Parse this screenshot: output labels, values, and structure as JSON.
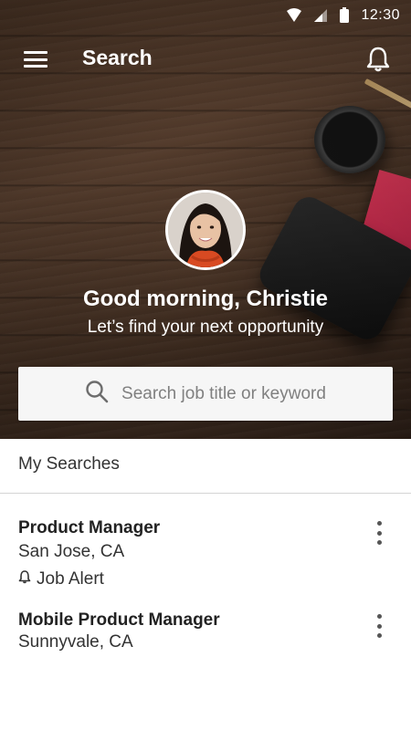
{
  "status_bar": {
    "time": "12:30",
    "icons": [
      "wifi-icon",
      "cell-signal-icon",
      "battery-icon"
    ]
  },
  "app_bar": {
    "title": "Search",
    "menu_icon": "hamburger-menu-icon",
    "notification_icon": "bell-icon"
  },
  "profile": {
    "greeting": "Good morning, Christie",
    "subtitle": "Let’s find your next opportunity"
  },
  "search": {
    "placeholder": "Search job title or keyword",
    "icon": "search-icon"
  },
  "my_searches": {
    "header": "My Searches",
    "items": [
      {
        "title": "Product Manager",
        "location": "San Jose, CA",
        "alert_label": "Job Alert",
        "has_alert": true
      },
      {
        "title": "Mobile Product Manager",
        "location": "Sunnyvale, CA",
        "alert_label": "",
        "has_alert": false
      }
    ]
  },
  "colors": {
    "accent_white": "#ffffff",
    "search_bg": "#f6f6f6",
    "placeholder": "#808080",
    "divider": "#d4d4d4",
    "hero_wood": "#4a3425"
  }
}
